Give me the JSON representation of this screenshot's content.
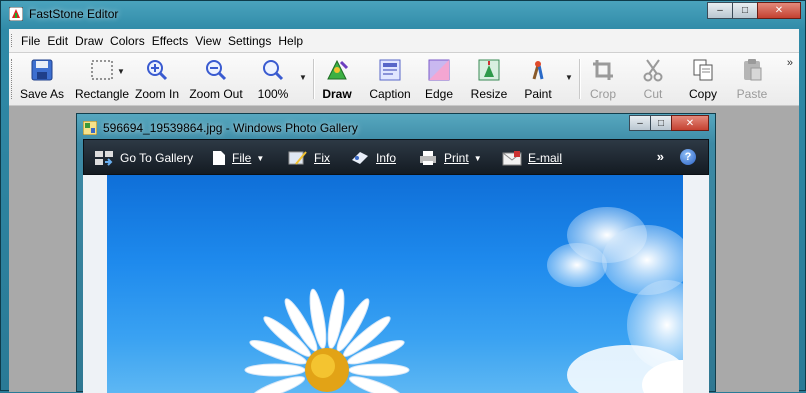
{
  "app": {
    "title": "FastStone Editor",
    "window_buttons": {
      "minimize": "–",
      "maximize": "□",
      "close": "✕"
    }
  },
  "menu": [
    "File",
    "Edit",
    "Draw",
    "Colors",
    "Effects",
    "View",
    "Settings",
    "Help"
  ],
  "toolbar": {
    "items": [
      {
        "label": "Save As",
        "icon": "save-icon",
        "enabled": true
      },
      {
        "label": "Rectangle",
        "icon": "rectangle-select-icon",
        "enabled": true
      },
      {
        "label": "Zoom In",
        "icon": "zoom-in-icon",
        "enabled": true
      },
      {
        "label": "Zoom Out",
        "icon": "zoom-out-icon",
        "enabled": true
      },
      {
        "label": "100%",
        "icon": "zoom-actual-icon",
        "enabled": true
      },
      {
        "label": "Draw",
        "icon": "draw-icon",
        "enabled": true
      },
      {
        "label": "Caption",
        "icon": "caption-icon",
        "enabled": true
      },
      {
        "label": "Edge",
        "icon": "edge-icon",
        "enabled": true
      },
      {
        "label": "Resize",
        "icon": "resize-icon",
        "enabled": true
      },
      {
        "label": "Paint",
        "icon": "paint-icon",
        "enabled": true
      },
      {
        "label": "Crop",
        "icon": "crop-icon",
        "enabled": false
      },
      {
        "label": "Cut",
        "icon": "cut-icon",
        "enabled": false
      },
      {
        "label": "Copy",
        "icon": "copy-icon",
        "enabled": true
      },
      {
        "label": "Paste",
        "icon": "paste-icon",
        "enabled": false
      }
    ],
    "more": "»"
  },
  "photo_window": {
    "title": "596694_19539864.jpg - Windows Photo Gallery",
    "window_buttons": {
      "minimize": "–",
      "maximize": "□",
      "close": "✕"
    },
    "commands": [
      {
        "label": "Go To Gallery",
        "icon": "gallery-icon"
      },
      {
        "label": "File",
        "icon": "file-icon",
        "dropdown": true
      },
      {
        "label": "Fix",
        "icon": "fix-icon"
      },
      {
        "label": "Info",
        "icon": "info-icon"
      },
      {
        "label": "Print",
        "icon": "print-icon",
        "dropdown": true
      },
      {
        "label": "E-mail",
        "icon": "email-icon"
      }
    ],
    "more": "»",
    "help": "?"
  },
  "colors": {
    "disabled_text": "#9a9a9a",
    "photo_sky": "#1e8aed",
    "gallery_bar": "#141b22"
  }
}
